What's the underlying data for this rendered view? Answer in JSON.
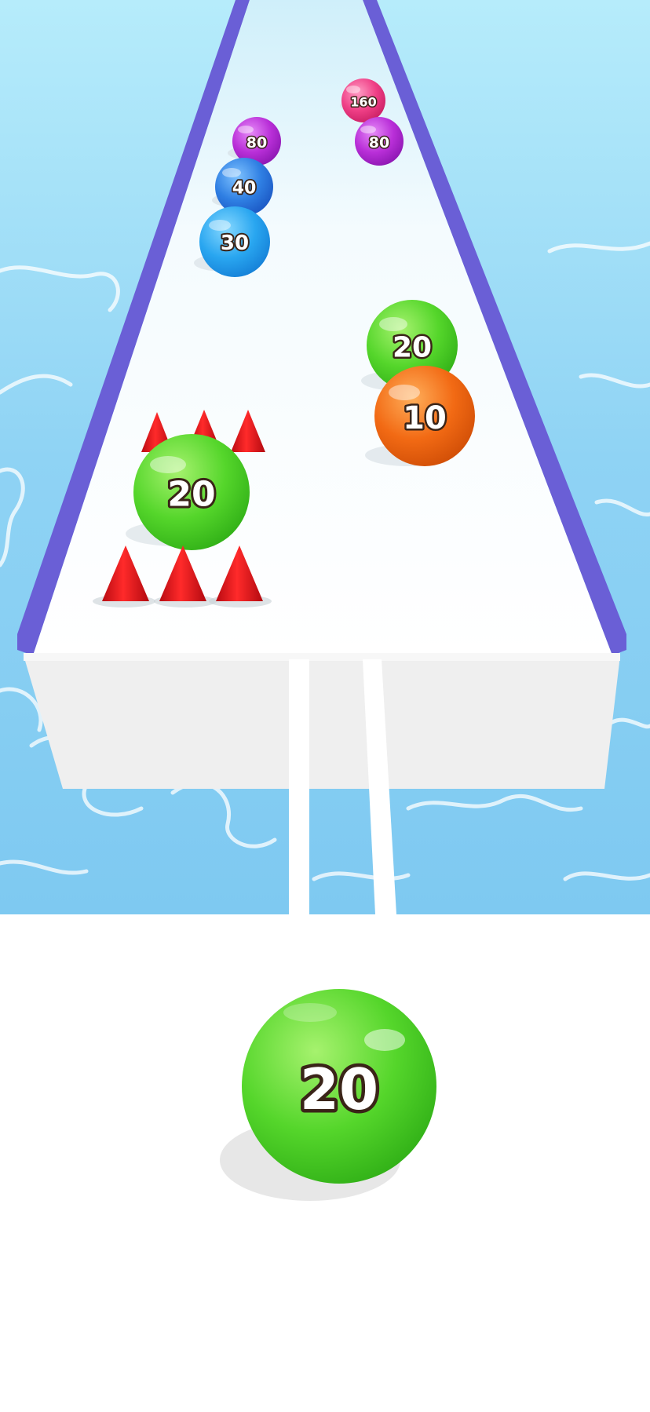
{
  "game": {
    "track_balls": [
      {
        "label": "160",
        "color": "pink"
      },
      {
        "label": "80",
        "color": "purple"
      },
      {
        "label": "80",
        "color": "purple"
      },
      {
        "label": "40",
        "color": "blue"
      },
      {
        "label": "30",
        "color": "light-blue"
      },
      {
        "label": "20",
        "color": "green"
      },
      {
        "label": "10",
        "color": "orange"
      },
      {
        "label": "20",
        "color": "green"
      }
    ],
    "player_ball": {
      "label": "20",
      "color": "green"
    }
  },
  "colors": {
    "water": "#8fd3f4",
    "track": "#ffffff",
    "rail": "#6a5fd6",
    "spike": "#e0151c",
    "green": "#55d62b",
    "orange": "#f26a14",
    "blue": "#2f8ee8",
    "light-blue": "#29a6f0",
    "purple": "#b92fd8",
    "pink": "#ef3f86"
  }
}
